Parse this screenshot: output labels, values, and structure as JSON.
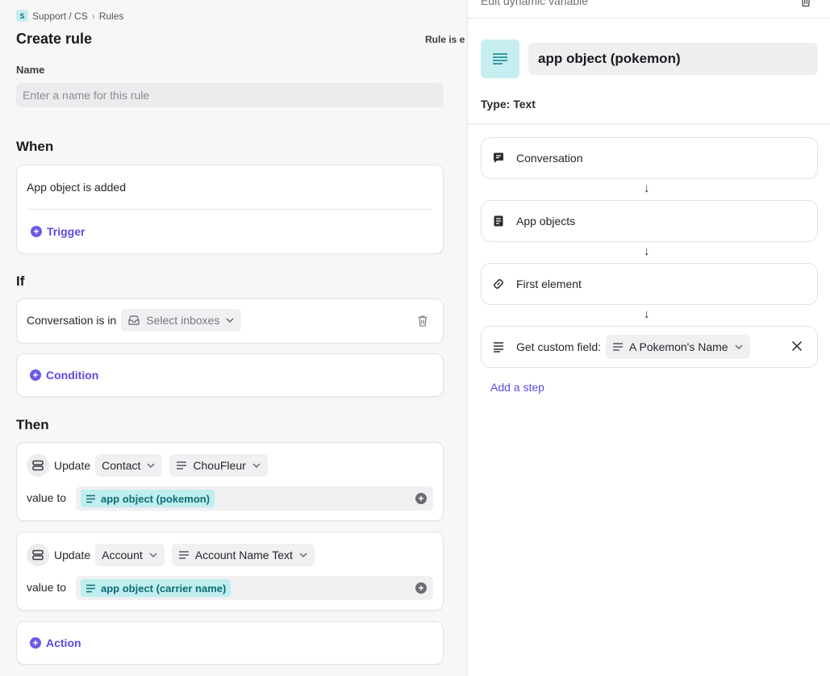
{
  "breadcrumb": {
    "workspace_initial": "S",
    "workspace": "Support / CS",
    "separator": "›",
    "page": "Rules"
  },
  "page": {
    "title": "Create rule",
    "status_partial": "Rule is e"
  },
  "name_field": {
    "label": "Name",
    "placeholder": "Enter a name for this rule",
    "value": ""
  },
  "when": {
    "heading": "When",
    "trigger_text": "App object is added",
    "add_label": "Trigger"
  },
  "if": {
    "heading": "If",
    "condition_text": "Conversation is in",
    "inbox_placeholder": "Select inboxes",
    "add_label": "Condition"
  },
  "then": {
    "heading": "Then",
    "actions": [
      {
        "verb": "Update",
        "object": "Contact",
        "field": "ChouFleur",
        "value_label": "value to",
        "value_chip": "app object (pokemon)"
      },
      {
        "verb": "Update",
        "object": "Account",
        "field": "Account Name Text",
        "value_label": "value to",
        "value_chip": "app object (carrier name)"
      }
    ],
    "add_label": "Action"
  },
  "panel": {
    "header": "Edit dynamic variable",
    "variable_name": "app object (pokemon)",
    "type_label": "Type: Text",
    "steps": [
      {
        "icon": "chat-bubble-icon",
        "label": "Conversation"
      },
      {
        "icon": "document-icon",
        "label": "App objects"
      },
      {
        "icon": "link-icon",
        "label": "First element"
      },
      {
        "icon": "text-lines-icon",
        "label": "Get custom field:",
        "field_value": "A Pokemon's Name"
      }
    ],
    "arrow": "↓",
    "add_step_label": "Add a step"
  },
  "colors": {
    "accent": "#5b4be0",
    "chip_bg": "#bfeef0",
    "chip_text": "#0e6c73",
    "panel_icon_bg": "#c6eef1"
  }
}
